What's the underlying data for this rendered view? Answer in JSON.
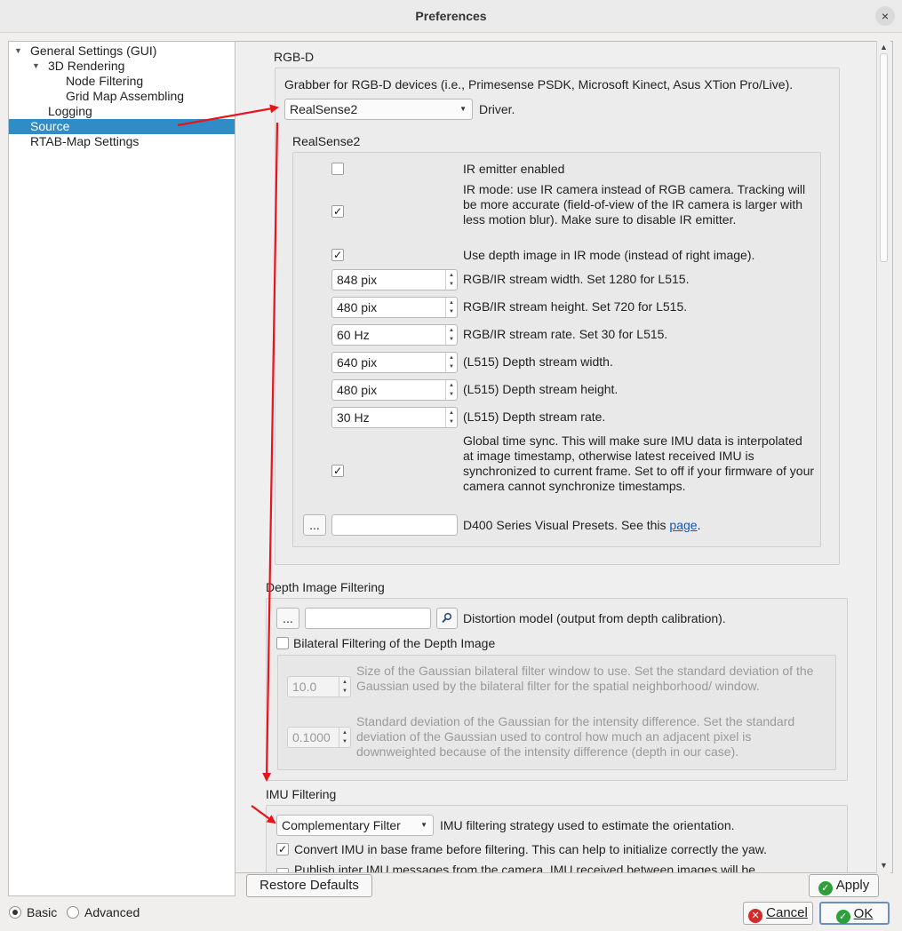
{
  "window": {
    "title": "Preferences",
    "close_symbol": "×"
  },
  "tree": {
    "items": [
      {
        "label": "General Settings (GUI)",
        "expanded": true
      },
      {
        "label": "3D Rendering",
        "expanded": true
      },
      {
        "label": "Node Filtering"
      },
      {
        "label": "Grid Map Assembling"
      },
      {
        "label": "Logging"
      },
      {
        "label": "Source",
        "selected": true
      },
      {
        "label": "RTAB-Map Settings"
      }
    ]
  },
  "rgbd": {
    "group_title": "RGB-D",
    "grabber_desc": "Grabber for RGB-D devices (i.e., Primesense PSDK, Microsoft Kinect, Asus XTion Pro/Live).",
    "driver_value": "RealSense2",
    "driver_label": "Driver.",
    "realsense": {
      "group_title": "RealSense2",
      "ir_emitter": {
        "checked": false,
        "label": "IR emitter enabled"
      },
      "ir_mode": {
        "checked": true,
        "label": "IR mode: use IR camera instead of RGB camera. Tracking will be more accurate (field-of-view of the IR camera is larger with less motion blur). Make sure to disable IR emitter."
      },
      "depth_ir": {
        "checked": true,
        "label": "Use depth image in IR mode (instead of right image)."
      },
      "spins": [
        {
          "value": "848 pix",
          "label": "RGB/IR stream width. Set 1280 for L515."
        },
        {
          "value": "480 pix",
          "label": "RGB/IR stream height. Set 720 for L515."
        },
        {
          "value": "60 Hz",
          "label": "RGB/IR stream rate. Set 30 for L515."
        },
        {
          "value": "640 pix",
          "label": "(L515) Depth stream width."
        },
        {
          "value": "480 pix",
          "label": "(L515) Depth stream height."
        },
        {
          "value": "30 Hz",
          "label": "(L515) Depth stream rate."
        }
      ],
      "global_sync": {
        "checked": true,
        "label": "Global time sync. This will make sure IMU data is interpolated at image timestamp, otherwise latest received IMU is synchronized to current frame. Set to off if your firmware of your camera cannot synchronize timestamps."
      },
      "presets": {
        "browse": "...",
        "value": "",
        "label_prefix": "D400 Series Visual Presets. See this ",
        "link": "page",
        "label_suffix": "."
      }
    }
  },
  "depth_filtering": {
    "group_title": "Depth Image Filtering",
    "browse": "...",
    "path_value": "",
    "distortion_label": "Distortion model (output from depth calibration).",
    "bilateral": {
      "checked": false,
      "label": "Bilateral Filtering of the Depth Image"
    },
    "sigma_s": {
      "value": "10.0",
      "label": "Size of the Gaussian bilateral filter window to use. Set the standard deviation of the Gaussian used by the bilateral filter for the spatial neighborhood/ window."
    },
    "sigma_r": {
      "value": "0.1000",
      "label": "Standard deviation of the Gaussian for the intensity difference. Set the standard deviation of the Gaussian used to control how much an adjacent pixel is downweighted because of the intensity difference (depth in our case)."
    }
  },
  "imu": {
    "group_title": "IMU Filtering",
    "strategy_value": "Complementary Filter",
    "strategy_label": "IMU filtering strategy used to estimate the orientation.",
    "convert": {
      "checked": true,
      "label": "Convert IMU in base frame before filtering. This can help to initialize correctly the yaw."
    },
    "publish": {
      "checked": false,
      "label": "Publish inter IMU messages from the camera. IMU received between images will be"
    }
  },
  "buttons": {
    "restore": "Restore Defaults",
    "apply": "Apply",
    "cancel": "Cancel",
    "ok": "OK"
  },
  "mode": {
    "basic": "Basic",
    "advanced": "Advanced",
    "selected": "basic"
  },
  "colors": {
    "selection": "#308cc6",
    "annotation_arrow": "#e8131b",
    "apply_icon": "#2e9f3a",
    "cancel_icon": "#d42a2a",
    "link": "#0b58c4"
  }
}
